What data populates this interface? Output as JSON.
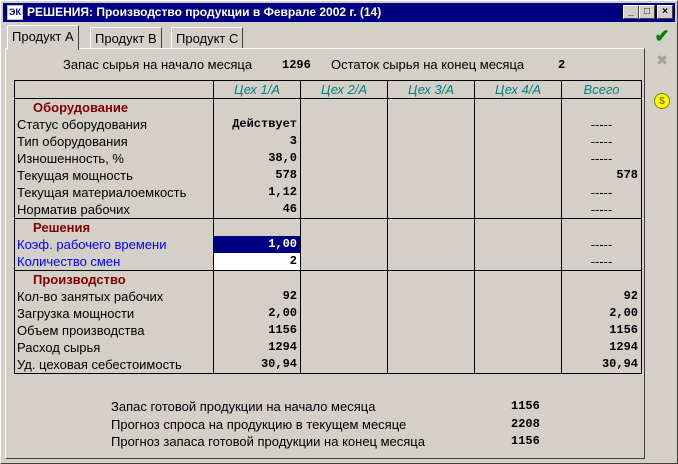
{
  "window": {
    "title": "РЕШЕНИЯ: Производство продукции в Феврале 2002 г. (14)",
    "app_icon_text": "ЭК",
    "minimize_glyph": "_",
    "maximize_glyph": "□",
    "close_glyph": "×"
  },
  "tabs": [
    {
      "label": "Продукт A",
      "active": true
    },
    {
      "label": "Продукт B",
      "active": false
    },
    {
      "label": "Продукт C",
      "active": false
    }
  ],
  "sidebar": {
    "ok_icon": "checkmark-icon",
    "cancel_icon": "cross-icon",
    "help_icon": "coin-icon",
    "ok_glyph": "✔",
    "cancel_glyph": "✖",
    "help_glyph": "$"
  },
  "summary": {
    "raw_start_label": "Запас сырья на начало месяца",
    "raw_start_value": "1296",
    "raw_end_label": "Остаток сырья на конец месяца",
    "raw_end_value": "2"
  },
  "columns": [
    "Цех 1/A",
    "Цех 2/A",
    "Цех 3/A",
    "Цех 4/A",
    "Всего"
  ],
  "sections": {
    "equipment": "Оборудование",
    "decisions": "Решения",
    "production": "Производство"
  },
  "equipment_rows": [
    {
      "label": "Статус оборудования",
      "c1": "Действует",
      "total": "-----"
    },
    {
      "label": "Тип оборудования",
      "c1": "3",
      "total": "-----"
    },
    {
      "label": "Изношенность, %",
      "c1": "38,0",
      "total": "-----"
    },
    {
      "label": "Текущая мощность",
      "c1": "578",
      "total": "578"
    },
    {
      "label": "Текущая материалоемкость",
      "c1": "1,12",
      "total": "-----"
    },
    {
      "label": "Норматив рабочих",
      "c1": "46",
      "total": "-----"
    }
  ],
  "decision_rows": [
    {
      "label": "Коэф. рабочего времени",
      "c1": "1,00",
      "total": "-----"
    },
    {
      "label": "Количество смен",
      "c1": "2",
      "total": "-----"
    }
  ],
  "production_rows": [
    {
      "label": "Кол-во занятых рабочих",
      "c1": "92",
      "total": "92"
    },
    {
      "label": "Загрузка мощности",
      "c1": "2,00",
      "total": "2,00"
    },
    {
      "label": "Объем производства",
      "c1": "1156",
      "total": "1156"
    },
    {
      "label": "Расход сырья",
      "c1": "1294",
      "total": "1294"
    },
    {
      "label": "Уд. цеховая себестоимость",
      "c1": "30,94",
      "total": "30,94"
    }
  ],
  "footer": [
    {
      "label": "Запас готовой продукции на начало месяца",
      "value": "1156"
    },
    {
      "label": "Прогноз спроса на продукцию в текущем месяце",
      "value": "2208"
    },
    {
      "label": "Прогноз запаса готовой продукции на конец месяца",
      "value": "1156"
    }
  ],
  "colors": {
    "titlebar": "#000080",
    "section": "#800000",
    "column_header": "#008080",
    "decision_label": "#0000ff"
  }
}
